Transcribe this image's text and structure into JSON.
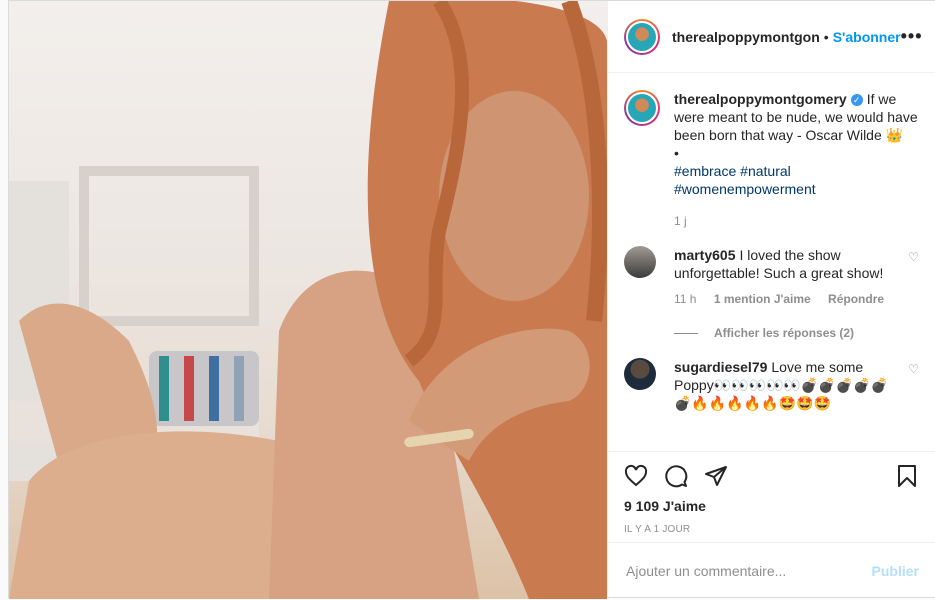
{
  "post": {
    "username_header": "therealpoppymontgon",
    "follow_label": "S'abonner",
    "more_label": "•••",
    "caption_user": "therealpoppymontgomery",
    "caption_text": "If we were meant to be nude, we would have been born that way - Oscar Wilde 👑",
    "caption_bullet": "•",
    "hashtags": [
      "#embrace",
      "#natural",
      "#womenempowerment"
    ],
    "caption_time": "1 j",
    "likes": "9 109 J'aime",
    "posted_ago": "IL Y A 1 JOUR"
  },
  "comments": [
    {
      "user": "marty605",
      "text": "I loved the show unforgettable! Such a great show!",
      "time": "11 h",
      "likes": "1 mention J'aime",
      "reply": "Répondre",
      "view_replies": "Afficher les réponses (2)"
    },
    {
      "user": "sugardiesel79",
      "text": "Love me some Poppy👀👀👀👀👀💣💣💣💣💣💣🔥🔥🔥🔥🔥🤩🤩🤩"
    }
  ],
  "composer": {
    "placeholder": "Ajouter un commentaire...",
    "publish_label": "Publier"
  },
  "icons": [
    "heart-icon",
    "comment-icon",
    "share-icon",
    "bookmark-icon"
  ]
}
